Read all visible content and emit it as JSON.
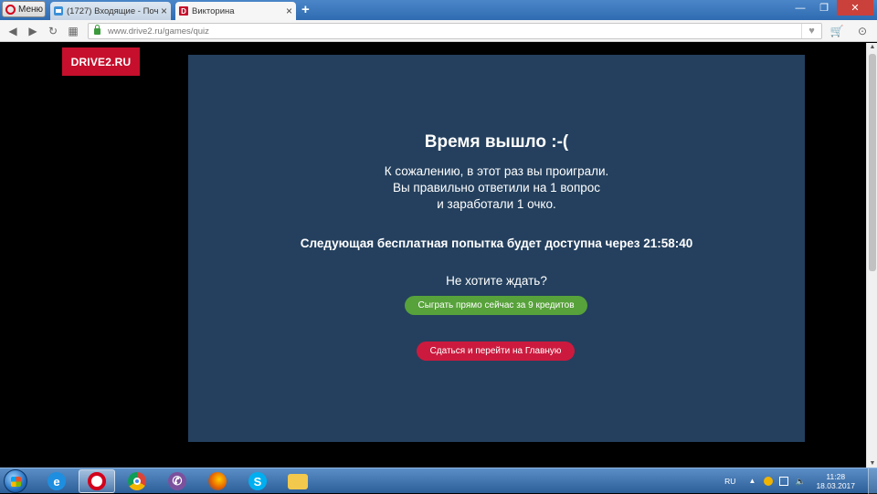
{
  "browser": {
    "menu_label": "Меню",
    "tabs": [
      {
        "label": "(1727) Входящие - Почта",
        "active": false
      },
      {
        "label": "Викторина",
        "active": true
      }
    ],
    "new_tab": "+",
    "url": "www.drive2.ru/games/quiz"
  },
  "site": {
    "logo": "DRIVE2.RU"
  },
  "quiz": {
    "title": "Время вышло :-(",
    "message_lines": [
      "К сожалению, в этот раз вы проиграли.",
      "Вы правильно ответили на 1 вопрос",
      "и заработали 1 очко."
    ],
    "next_attempt": "Следующая бесплатная попытка будет доступна через 21:58:40",
    "wait_question": "Не хотите ждать?",
    "play_now_button": "Сыграть прямо сейчас за 9 кредитов",
    "give_up_button": "Сдаться и перейти на Главную"
  },
  "colors": {
    "panel_bg": "#24405e",
    "logo_bg": "#c60f2c",
    "green_button": "#57a23a",
    "red_button": "#cc1a3e"
  },
  "taskbar": {
    "apps": [
      "internet-explorer",
      "opera",
      "chrome",
      "viber",
      "firefox",
      "skype",
      "file-explorer"
    ],
    "language": "RU",
    "time": "11:28",
    "date": "18.03.2017"
  }
}
